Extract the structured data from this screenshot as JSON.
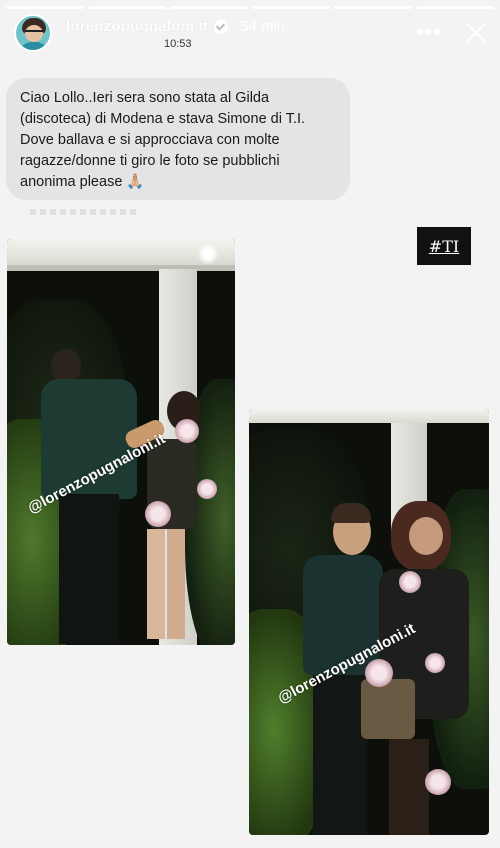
{
  "story": {
    "progress_segments": 6,
    "header": {
      "username": "lorenzopugnaloni.it",
      "time_ago": "54 min",
      "clock": "10:53",
      "more_icon": "more-horizontal-icon",
      "close_icon": "close-icon"
    },
    "message": {
      "text": "Ciao Lollo..Ieri sera sono stata al Gilda (discoteca) di Modena e stava  Simone di T.I. Dove ballava e si approcciava con molte ragazze/donne ti giro le foto se pubblichi anonima please 🙏🏼"
    },
    "sticker": {
      "text": "#TI"
    },
    "photos": [
      {
        "watermark": "@lorenzopugnaloni.it"
      },
      {
        "watermark": "@lorenzopugnaloni.it"
      }
    ],
    "colors": {
      "background": "#f3f3f3",
      "bubble": "#e4e4e6",
      "sticker": "#111111"
    }
  }
}
